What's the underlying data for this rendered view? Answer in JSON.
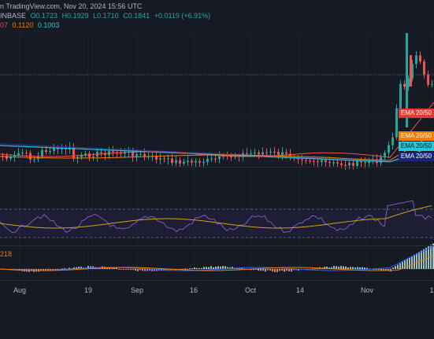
{
  "header": {
    "line1": {
      "source_text": "n TradingView.com, Nov 20, 2024 15:56 UTC"
    },
    "line2": {
      "exchange": "INBASE",
      "open": "O0.1723",
      "high": "H0.1929",
      "low": "L0.1710",
      "close": "C0.1841",
      "change": "+0.0119 (+6.91%)"
    },
    "line3": {
      "v1": "07",
      "v2": "0.1120",
      "v3": "0.1003"
    }
  },
  "ema_badges": [
    {
      "label": "EMA 20/50",
      "color": "#e53935"
    },
    {
      "label": "EMA 20/50",
      "color": "#f57c00"
    },
    {
      "label": "EMA 20/50",
      "color": "#26c6da"
    },
    {
      "label": "EMA 20/50",
      "color": "#1a237e"
    }
  ],
  "macd_label": "218",
  "x_axis": {
    "labels": [
      "Aug",
      "19",
      "Sep",
      "16",
      "Oct",
      "14",
      "Nov",
      "1"
    ]
  },
  "colors": {
    "background": "#161a25",
    "up": "#26a69a",
    "down": "#ef5350",
    "rsi_line": "#7e57c2",
    "rsi_ma": "#d4a017",
    "ema_fast": "#ef5350",
    "ema_mid": "#f57c00",
    "ema_slow": "#26c6da",
    "ema_long": "#283593"
  }
}
